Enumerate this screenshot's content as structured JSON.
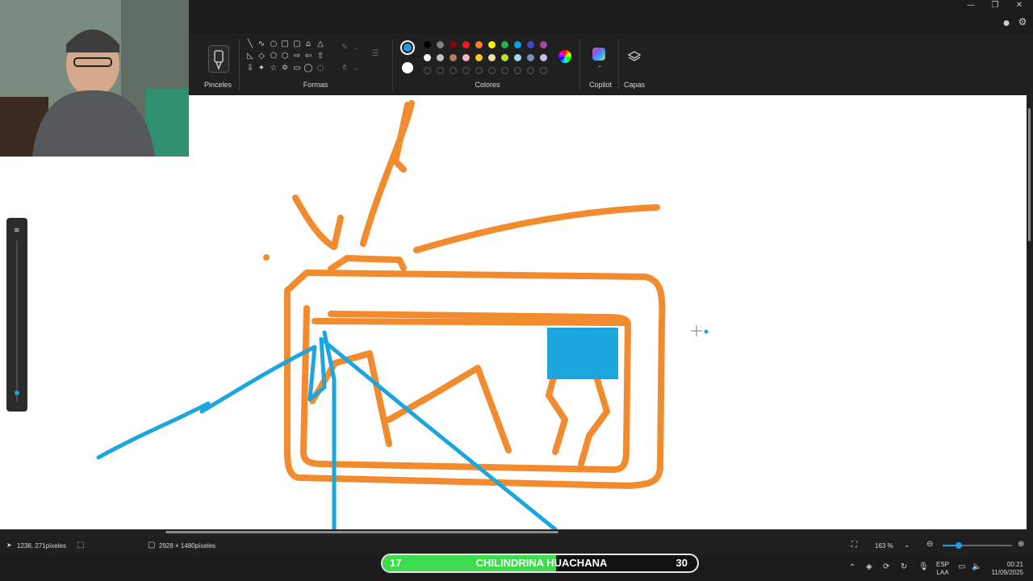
{
  "ribbon": {
    "brushes_label": "Pinceles",
    "shapes_label": "Formas",
    "colors_label": "Colores",
    "copilot_label": "Copilot",
    "layers_label": "Capas",
    "selected_color": "#1ba1e2",
    "palette_row1": [
      "#000000",
      "#7f7f7f",
      "#880015",
      "#ed1c24",
      "#ff7f27",
      "#fff200",
      "#22b14c",
      "#00a2e8",
      "#3f48cc",
      "#a349a4"
    ],
    "palette_row2": [
      "#ffffff",
      "#c3c3c3",
      "#b97a57",
      "#ffaec9",
      "#ffc90e",
      "#efe4b0",
      "#b5e61d",
      "#99d9ea",
      "#7092be",
      "#c8bfe7"
    ]
  },
  "status": {
    "cursor_position": "1238, 271píxeles",
    "image_size": "2928 × 1480píxeles",
    "zoom": "163 %"
  },
  "overlay": {
    "left_number": "17",
    "title": "CHILINDRINA HUACHANA",
    "right_number": "30",
    "progress": 0.55
  },
  "taskbar": {
    "language_top": "ESP",
    "language_bottom": "LAA",
    "time": "00:21",
    "date": "11/09/2025"
  },
  "colors": {
    "orange_stroke": "#f28a2e",
    "blue_stroke": "#1ba6de"
  }
}
